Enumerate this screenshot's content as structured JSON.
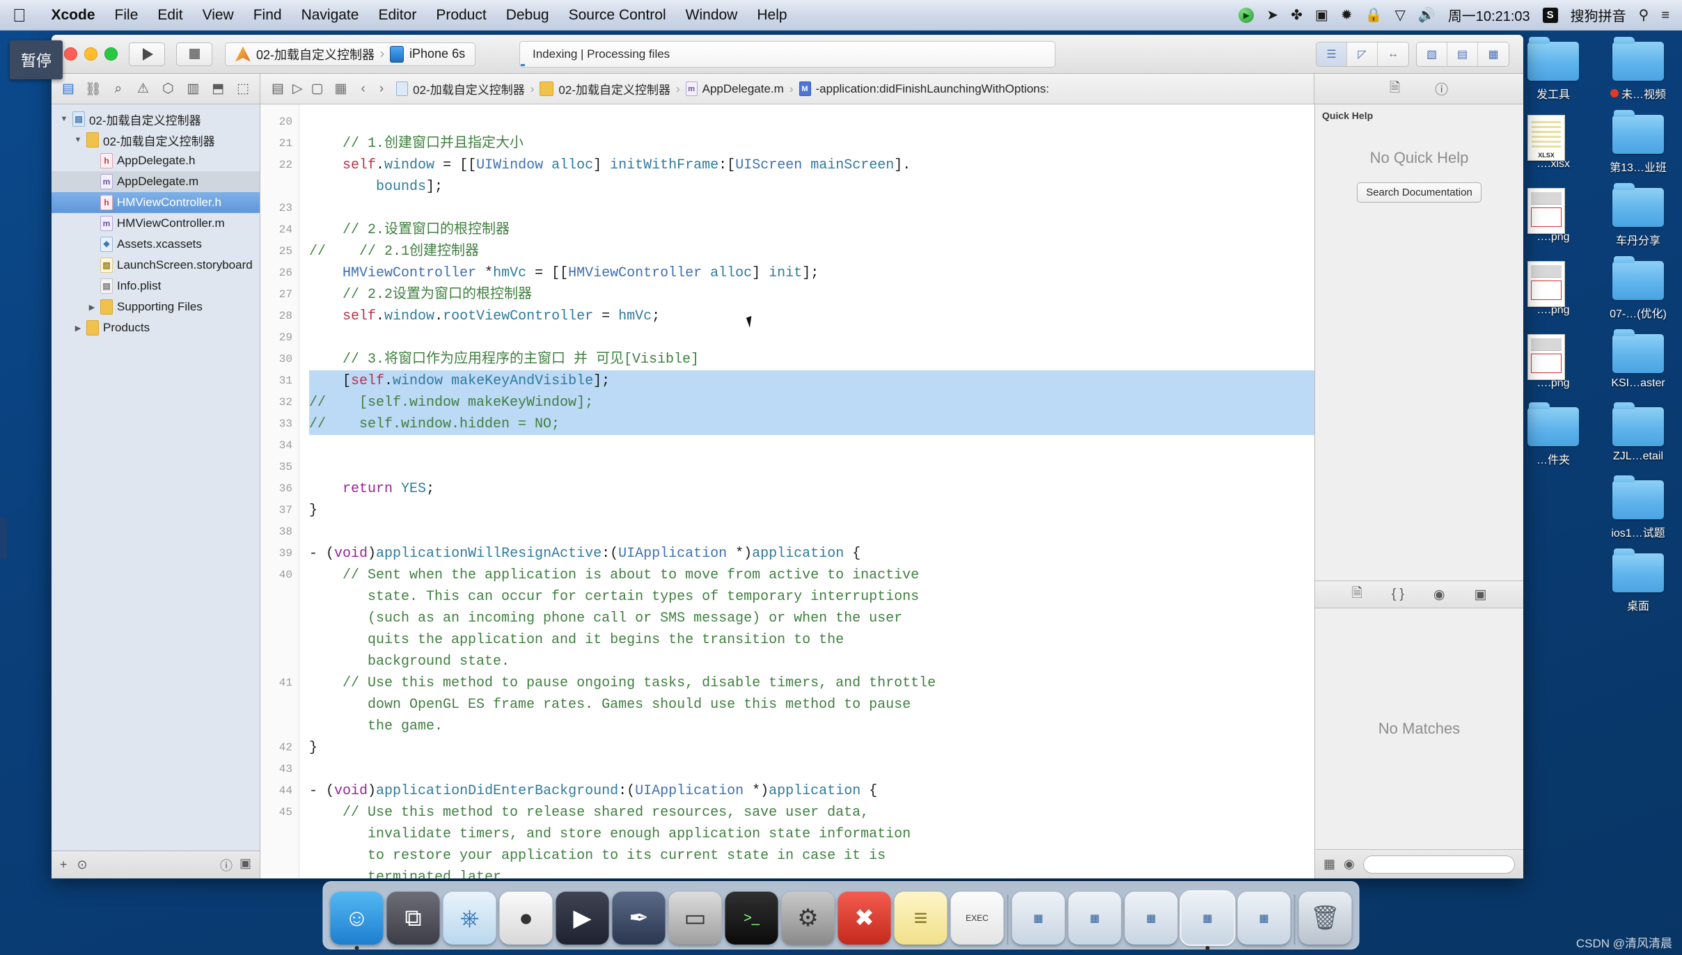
{
  "menubar": {
    "apple_icon": "apple-icon",
    "items": [
      {
        "label": "Xcode",
        "bold": true
      },
      {
        "label": "File",
        "bold": false
      },
      {
        "label": "Edit",
        "bold": false
      },
      {
        "label": "View",
        "bold": false
      },
      {
        "label": "Find",
        "bold": false
      },
      {
        "label": "Navigate",
        "bold": false
      },
      {
        "label": "Editor",
        "bold": false
      },
      {
        "label": "Product",
        "bold": false
      },
      {
        "label": "Debug",
        "bold": false
      },
      {
        "label": "Source Control",
        "bold": false
      },
      {
        "label": "Window",
        "bold": false
      },
      {
        "label": "Help",
        "bold": false
      }
    ],
    "status_icons": [
      {
        "name": "screen-recorder-icon",
        "glyph": "▶"
      },
      {
        "name": "location-icon",
        "glyph": "➤"
      },
      {
        "name": "bluetooth-icon",
        "glyph": "✤"
      },
      {
        "name": "camera-icon",
        "glyph": "▣"
      },
      {
        "name": "airdrop-icon",
        "glyph": "✹"
      },
      {
        "name": "lock-icon",
        "glyph": "ὑ2"
      },
      {
        "name": "wifi-icon",
        "glyph": "▽"
      },
      {
        "name": "volume-icon",
        "glyph": "🔊"
      }
    ],
    "clock": "周一10:21:03",
    "ime_badge": "S",
    "ime_label": "搜狗拼音",
    "search_icon": "search-icon",
    "control_center_icon": "list-icon"
  },
  "tooltip": {
    "text": "暂停"
  },
  "toolbar": {
    "run_button": "run-button",
    "stop_button": "stop-button",
    "scheme_name": "02-加载自定义控制器",
    "scheme_sep": "›",
    "destination": "iPhone 6s",
    "status_text": "Indexing  |  Processing files",
    "view_buttons": [
      "editor-standard",
      "editor-assistant",
      "editor-version"
    ],
    "panel_buttons": [
      "toggle-navigator",
      "toggle-debug-area",
      "toggle-inspector"
    ]
  },
  "navigator_bar": {
    "icons": [
      {
        "name": "project-navigator-icon",
        "glyph": "▤",
        "active": true
      },
      {
        "name": "source-control-navigator-icon",
        "glyph": "⛓",
        "active": false
      },
      {
        "name": "find-navigator-icon",
        "glyph": "⌕",
        "active": false
      },
      {
        "name": "issue-navigator-icon",
        "glyph": "⚠",
        "active": false
      },
      {
        "name": "test-navigator-icon",
        "glyph": "⬡",
        "active": false
      },
      {
        "name": "debug-navigator-icon",
        "glyph": "▥",
        "active": false
      },
      {
        "name": "breakpoint-navigator-icon",
        "glyph": "⬒",
        "active": false
      },
      {
        "name": "report-navigator-icon",
        "glyph": "⬚",
        "active": false
      }
    ]
  },
  "jump_bar": {
    "back_arrow": "‹",
    "forward_arrow": "›",
    "related_items_icon": "related-items-icon",
    "crumbs": [
      {
        "icon": "proj",
        "label": "02-加载自定义控制器"
      },
      {
        "icon": "fold",
        "label": "02-加载自定义控制器"
      },
      {
        "icon": "m",
        "label": "AppDelegate.m"
      },
      {
        "icon": "mm",
        "label": "-application:didFinishLaunchingWithOptions:"
      }
    ],
    "separator": "›"
  },
  "navigator": {
    "items": [
      {
        "label": "02-加载自定义控制器",
        "indent": 0,
        "disclosure": "▼",
        "icon": "proj",
        "state": "none"
      },
      {
        "label": "02-加载自定义控制器",
        "indent": 1,
        "disclosure": "▼",
        "icon": "fold",
        "state": "none"
      },
      {
        "label": "AppDelegate.h",
        "indent": 2,
        "disclosure": "",
        "icon": "h",
        "state": "none"
      },
      {
        "label": "AppDelegate.m",
        "indent": 2,
        "disclosure": "",
        "icon": "m",
        "state": "sel2"
      },
      {
        "label": "HMViewController.h",
        "indent": 2,
        "disclosure": "",
        "icon": "h",
        "state": "sel"
      },
      {
        "label": "HMViewController.m",
        "indent": 2,
        "disclosure": "",
        "icon": "m",
        "state": "none"
      },
      {
        "label": "Assets.xcassets",
        "indent": 2,
        "disclosure": "",
        "icon": "assets",
        "state": "none"
      },
      {
        "label": "LaunchScreen.storyboard",
        "indent": 2,
        "disclosure": "",
        "icon": "story",
        "state": "none"
      },
      {
        "label": "Info.plist",
        "indent": 2,
        "disclosure": "",
        "icon": "plist",
        "state": "none"
      },
      {
        "label": "Supporting Files",
        "indent": 2,
        "disclosure": "▶",
        "icon": "fold",
        "state": "none"
      },
      {
        "label": "Products",
        "indent": 1,
        "disclosure": "▶",
        "icon": "fold",
        "state": "none"
      }
    ],
    "footer": {
      "add_button": "+",
      "filter_button": "⊙",
      "recent_button": "ⓘ",
      "status_button": "▣"
    }
  },
  "editor": {
    "first_line_number": 20,
    "lines": [
      {
        "n": 20,
        "text": "",
        "hl": false,
        "tokens": []
      },
      {
        "n": 21,
        "text": "    // 1.创建窗口并且指定大小",
        "hl": false
      },
      {
        "n": 22,
        "text": "    self.window = [[UIWindow alloc] initWithFrame:[UIScreen mainScreen].",
        "hl": false
      },
      {
        "n": "",
        "text": "        bounds];",
        "hl": false
      },
      {
        "n": 23,
        "text": "",
        "hl": false
      },
      {
        "n": 24,
        "text": "    // 2.设置窗口的根控制器",
        "hl": false
      },
      {
        "n": 25,
        "text": "//    // 2.1创建控制器",
        "hl": false
      },
      {
        "n": 26,
        "text": "    HMViewController *hmVc = [[HMViewController alloc] init];",
        "hl": false
      },
      {
        "n": 27,
        "text": "    // 2.2设置为窗口的根控制器",
        "hl": false
      },
      {
        "n": 28,
        "text": "    self.window.rootViewController = hmVc;",
        "hl": false
      },
      {
        "n": 29,
        "text": "",
        "hl": false
      },
      {
        "n": 30,
        "text": "    // 3.将窗口作为应用程序的主窗口 并 可见[Visible]",
        "hl": false
      },
      {
        "n": 31,
        "text": "    [self.window makeKeyAndVisible];",
        "hl": true
      },
      {
        "n": 32,
        "text": "//    [self.window makeKeyWindow];",
        "hl": true
      },
      {
        "n": 33,
        "text": "//    self.window.hidden = NO;",
        "hl": true
      },
      {
        "n": 34,
        "text": "",
        "hl": false
      },
      {
        "n": 35,
        "text": "",
        "hl": false
      },
      {
        "n": 36,
        "text": "    return YES;",
        "hl": false
      },
      {
        "n": 37,
        "text": "}",
        "hl": false
      },
      {
        "n": 38,
        "text": "",
        "hl": false
      },
      {
        "n": 39,
        "text": "- (void)applicationWillResignActive:(UIApplication *)application {",
        "hl": false
      },
      {
        "n": 40,
        "text": "    // Sent when the application is about to move from active to inactive",
        "hl": false
      },
      {
        "n": "",
        "text": "       state. This can occur for certain types of temporary interruptions",
        "hl": false
      },
      {
        "n": "",
        "text": "       (such as an incoming phone call or SMS message) or when the user",
        "hl": false
      },
      {
        "n": "",
        "text": "       quits the application and it begins the transition to the",
        "hl": false
      },
      {
        "n": "",
        "text": "       background state.",
        "hl": false
      },
      {
        "n": 41,
        "text": "    // Use this method to pause ongoing tasks, disable timers, and throttle",
        "hl": false
      },
      {
        "n": "",
        "text": "       down OpenGL ES frame rates. Games should use this method to pause",
        "hl": false
      },
      {
        "n": "",
        "text": "       the game.",
        "hl": false
      },
      {
        "n": 42,
        "text": "}",
        "hl": false
      },
      {
        "n": 43,
        "text": "",
        "hl": false
      },
      {
        "n": 44,
        "text": "- (void)applicationDidEnterBackground:(UIApplication *)application {",
        "hl": false
      },
      {
        "n": 45,
        "text": "    // Use this method to release shared resources, save user data,",
        "hl": false
      },
      {
        "n": "",
        "text": "       invalidate timers, and store enough application state information",
        "hl": false
      },
      {
        "n": "",
        "text": "       to restore your application to its current state in case it is",
        "hl": false
      },
      {
        "n": "",
        "text": "       terminated later.",
        "hl": false
      }
    ]
  },
  "inspector": {
    "tab_icons": [
      "file-inspector-icon",
      "quick-help-inspector-icon"
    ],
    "quick_help_title": "Quick Help",
    "no_quick_help": "No Quick Help",
    "search_documentation": "Search Documentation",
    "library_icons": [
      "file-template-library-icon",
      "code-snippet-library-icon",
      "object-library-icon",
      "media-library-icon"
    ],
    "library_empty": "No Matches",
    "library_footer": {
      "grid_icon": "grid-icon",
      "filter_icon": "filter-icon"
    }
  },
  "dock": {
    "items": [
      {
        "name": "finder",
        "glyph": "☺",
        "class": "dk-finder",
        "running": true
      },
      {
        "name": "launchpad",
        "glyph": "⧉",
        "class": "dk-launch",
        "running": false
      },
      {
        "name": "safari",
        "glyph": "⎈",
        "class": "dk-safari",
        "running": false
      },
      {
        "name": "mouse-utility",
        "glyph": "●",
        "class": "dk-mouse",
        "running": false
      },
      {
        "name": "video-player",
        "glyph": "▶",
        "class": "dk-video",
        "running": false
      },
      {
        "name": "pen-tool",
        "glyph": "✒",
        "class": "dk-pen",
        "running": false
      },
      {
        "name": "simulator",
        "glyph": "▭",
        "class": "dk-sim",
        "running": false
      },
      {
        "name": "terminal",
        "glyph": ">_",
        "class": "dk-term",
        "running": false
      },
      {
        "name": "system-preferences",
        "glyph": "⚙",
        "class": "dk-pref",
        "running": false
      },
      {
        "name": "xmind",
        "glyph": "✖",
        "class": "dk-x",
        "running": false
      },
      {
        "name": "notes",
        "glyph": "≡",
        "class": "dk-notes",
        "running": false
      },
      {
        "name": "exec-app",
        "glyph": "EXEC",
        "class": "dk-exec",
        "running": false
      },
      {
        "name": "window-1",
        "glyph": "▦",
        "class": "dk-win",
        "running": false
      },
      {
        "name": "window-2",
        "glyph": "▦",
        "class": "dk-win",
        "running": false
      },
      {
        "name": "window-3",
        "glyph": "▦",
        "class": "dk-win",
        "running": false
      },
      {
        "name": "window-4",
        "glyph": "▦",
        "class": "dk-win",
        "running": true
      },
      {
        "name": "window-5",
        "glyph": "▦",
        "class": "dk-win",
        "running": false
      }
    ],
    "trash": {
      "name": "trash",
      "glyph": "🗑"
    }
  },
  "desktop": {
    "icons": [
      {
        "label": "发工具",
        "type": "folder",
        "dot": false
      },
      {
        "label": "未…视频",
        "type": "folder",
        "dot": true
      },
      {
        "label": "….xlsx",
        "type": "xls",
        "dot": false
      },
      {
        "label": "第13…业班",
        "type": "folder",
        "dot": false
      },
      {
        "label": "….png",
        "type": "shot",
        "dot": false
      },
      {
        "label": "车丹分享",
        "type": "folder",
        "dot": false
      },
      {
        "label": "….png",
        "type": "shot",
        "dot": false
      },
      {
        "label": "07-…(优化)",
        "type": "folder",
        "dot": false
      },
      {
        "label": "….png",
        "type": "shot",
        "dot": false
      },
      {
        "label": "KSI…aster",
        "type": "folder",
        "dot": false
      },
      {
        "label": "…件夹",
        "type": "folder",
        "dot": false
      },
      {
        "label": "ZJL…etail",
        "type": "folder",
        "dot": false
      },
      {
        "label": "",
        "type": "none",
        "dot": false
      },
      {
        "label": "ios1…试题",
        "type": "folder",
        "dot": false
      },
      {
        "label": "",
        "type": "none",
        "dot": false
      },
      {
        "label": "桌面",
        "type": "folder",
        "dot": false
      }
    ]
  },
  "watermark": {
    "text": "CSDN @清风清晨"
  }
}
